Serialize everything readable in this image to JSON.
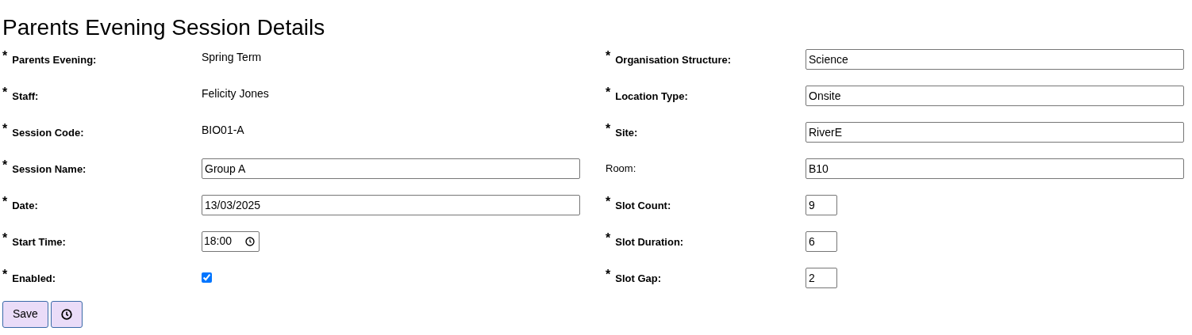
{
  "title": "Parents Evening Session Details",
  "required_mark": "*",
  "left_fields": [
    {
      "label": "Parents Evening:",
      "required": true,
      "kind": "text",
      "value": "Spring Term"
    },
    {
      "label": "Staff:",
      "required": true,
      "kind": "text",
      "value": "Felicity Jones"
    },
    {
      "label": "Session Code:",
      "required": true,
      "kind": "text",
      "value": "BIO01-A"
    },
    {
      "label": "Session Name:",
      "required": true,
      "kind": "input",
      "value": "Group A"
    },
    {
      "label": "Date:",
      "required": true,
      "kind": "input",
      "value": "13/03/2025"
    },
    {
      "label": "Start Time:",
      "required": true,
      "kind": "time",
      "value": "18:00"
    },
    {
      "label": "Enabled:",
      "required": true,
      "kind": "checkbox",
      "checked": true
    }
  ],
  "right_fields": [
    {
      "label": "Organisation Structure:",
      "required": true,
      "kind": "input",
      "value": "Science"
    },
    {
      "label": "Location Type:",
      "required": true,
      "kind": "input",
      "value": "Onsite"
    },
    {
      "label": "Site:",
      "required": true,
      "kind": "input",
      "value": "RiverE"
    },
    {
      "label": "Room:",
      "required": false,
      "kind": "input",
      "value": "B10"
    },
    {
      "label": "Slot Count:",
      "required": true,
      "kind": "number",
      "value": "9"
    },
    {
      "label": "Slot Duration:",
      "required": true,
      "kind": "number",
      "value": "6"
    },
    {
      "label": "Slot Gap:",
      "required": true,
      "kind": "number",
      "value": "2"
    }
  ],
  "buttons": [
    {
      "kind": "text",
      "label": "Save"
    },
    {
      "kind": "history"
    }
  ]
}
